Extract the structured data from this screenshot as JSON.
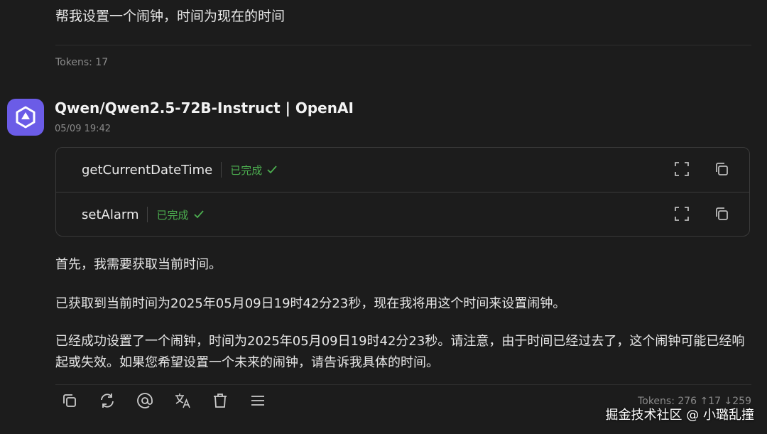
{
  "user_message": {
    "text": "帮我设置一个闹钟，时间为现在的时间",
    "tokens": "Tokens: 17"
  },
  "assistant": {
    "model_name": "Qwen/Qwen2.5-72B-Instruct | OpenAI",
    "timestamp": "05/09 19:42",
    "avatar_icon": "qwen-logo-icon",
    "accent_color": "#6b5ce7",
    "tool_calls": [
      {
        "name": "getCurrentDateTime",
        "status": "已完成"
      },
      {
        "name": "setAlarm",
        "status": "已完成"
      }
    ],
    "paragraphs": [
      "首先，我需要获取当前时间。",
      "已获取到当前时间为2025年05月09日19时42分23秒，现在我将用这个时间来设置闹钟。",
      "已经成功设置了一个闹钟，时间为2025年05月09日19时42分23秒。请注意，由于时间已经过去了，这个闹钟可能已经响起或失效。如果您希望设置一个未来的闹钟，请告诉我具体的时间。"
    ],
    "tokens": "Tokens: 276 ↑17 ↓259"
  },
  "actions": [
    "copy-icon",
    "refresh-icon",
    "mention-icon",
    "translate-icon",
    "delete-icon",
    "menu-icon"
  ],
  "status_color": "#4caf50",
  "watermark": "掘金技术社区 @ 小璐乱撞"
}
